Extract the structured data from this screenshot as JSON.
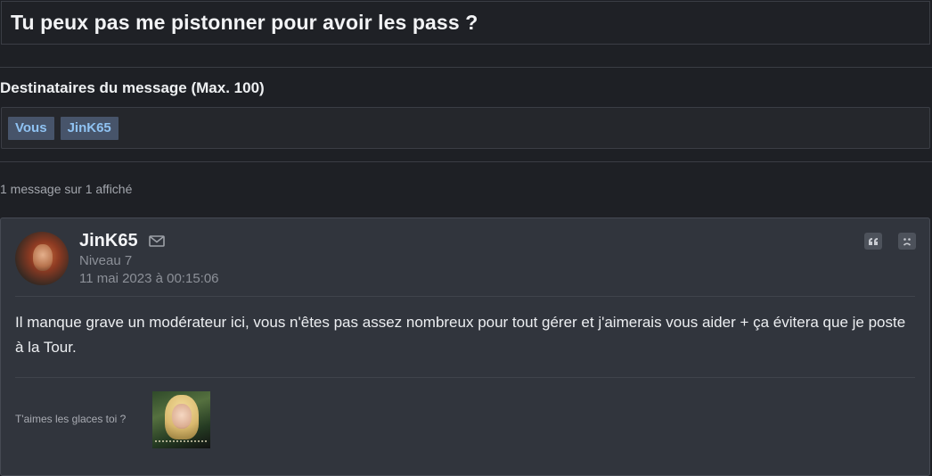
{
  "subject": "Tu peux pas me pistonner pour avoir les pass ?",
  "recipients": {
    "title": "Destinataires du message (Max. 100)",
    "chips": [
      "Vous",
      "JinK65"
    ]
  },
  "message_count": "1 message sur 1 affiché",
  "message": {
    "author": "JinK65",
    "level": "Niveau 7",
    "date": "11 mai 2023 à 00:15:06",
    "body": "Il manque grave un modérateur ici, vous n'êtes pas assez nombreux pour tout gérer et j'aimerais vous aider + ça évitera que je poste à la Tour.",
    "signature_text": "T'aimes les glaces toi ?"
  },
  "icons": {
    "mail": "mail-icon",
    "quote": "quote-icon",
    "report": "sad-face-icon"
  }
}
